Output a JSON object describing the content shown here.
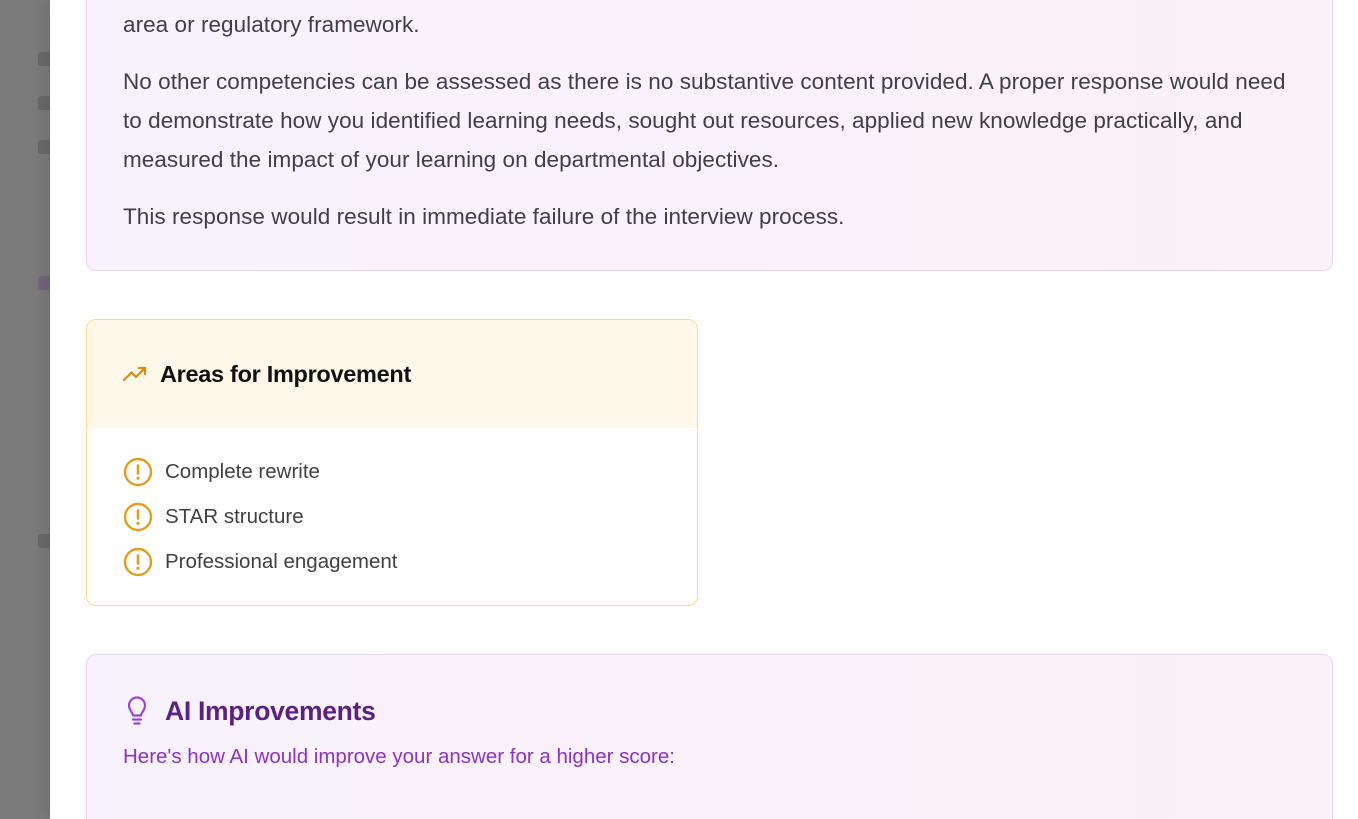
{
  "analysis": {
    "line_partial": "area or regulatory framework.",
    "paragraph_2": "No other competencies can be assessed as there is no substantive content provided. A proper response would need to demonstrate how you identified learning needs, sought out resources, applied new knowledge practically, and measured the impact of your learning on departmental objectives.",
    "paragraph_3": "This response would result in immediate failure of the interview process."
  },
  "improvement": {
    "title": "Areas for Improvement",
    "icon": "trending-up-icon",
    "items": [
      {
        "label": "Complete rewrite",
        "icon": "alert-circle-icon"
      },
      {
        "label": "STAR structure",
        "icon": "alert-circle-icon"
      },
      {
        "label": "Professional engagement",
        "icon": "alert-circle-icon"
      }
    ]
  },
  "ai": {
    "title": "AI Improvements",
    "icon": "lightbulb-icon",
    "subtitle": "Here's how AI would improve your answer for a higher score:"
  },
  "colors": {
    "amber_accent": "#e39f1c",
    "purple_title": "#5b1f86",
    "purple_text": "#8a33c4",
    "card_tint": "#f8f2fc"
  }
}
